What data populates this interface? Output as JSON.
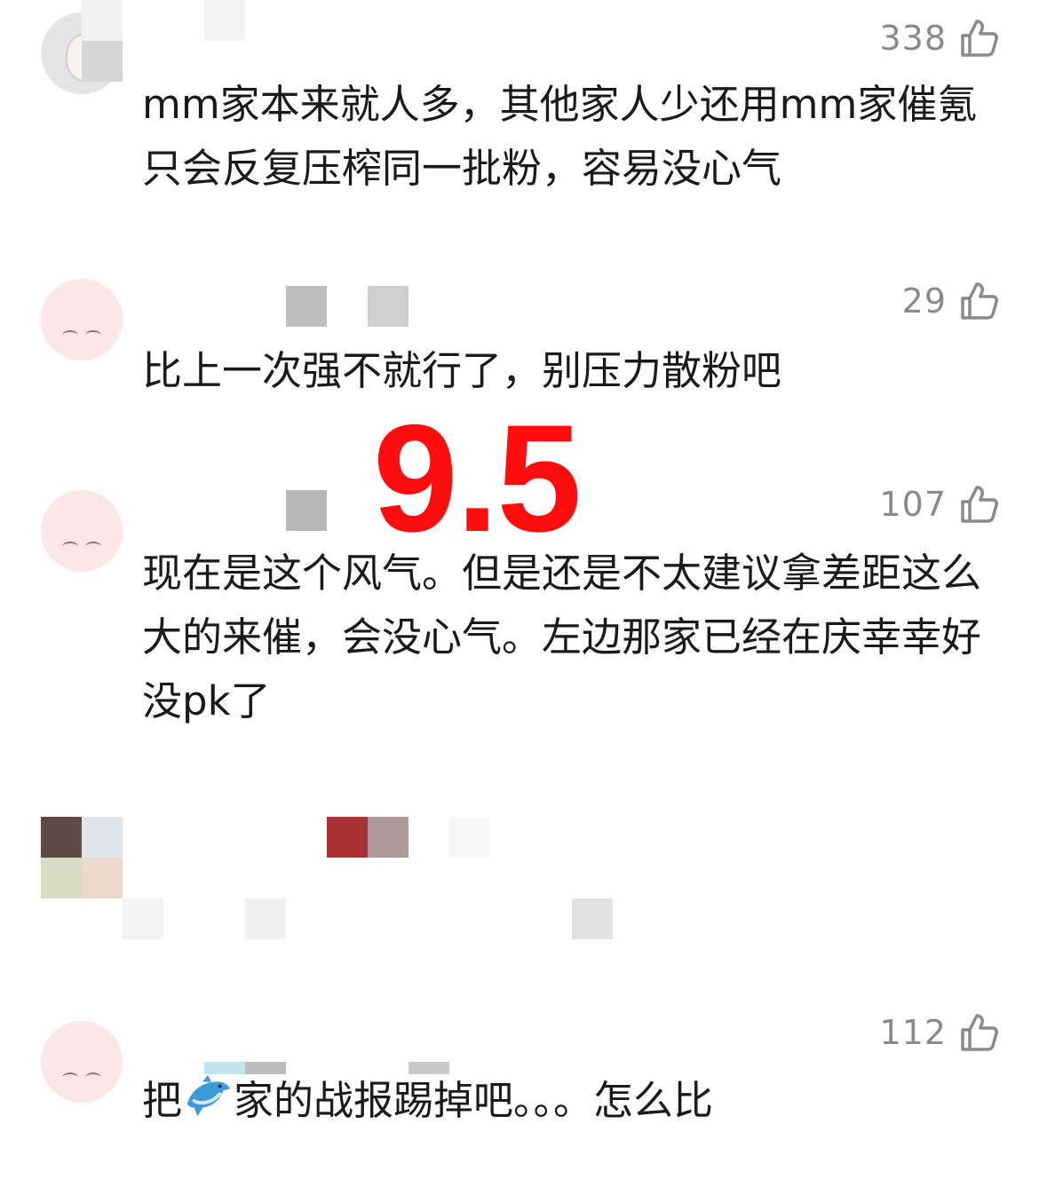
{
  "comments": [
    {
      "likes": "338",
      "text": "mm家本来就人多，其他家人少还用mm家催氪只会反复压榨同一批粉，容易没心气"
    },
    {
      "likes": "29",
      "text": "比上一次强不就行了，别压力散粉吧"
    },
    {
      "likes": "107",
      "text": "现在是这个风气。但是还是不太建议拿差距这么大的来催，会没心气。左边那家已经在庆幸幸好没pk了"
    },
    {
      "likes": "112",
      "text_before": "把",
      "text_after": "家的战报踢掉吧。。。怎么比"
    }
  ],
  "overlay": {
    "score": "9.5"
  },
  "colors": {
    "like_gray": "#8a8a8a",
    "score_red": "#ff0d0d"
  },
  "icons": {
    "like": "thumbs-up-icon",
    "emoji": "dolphin-emoji"
  }
}
